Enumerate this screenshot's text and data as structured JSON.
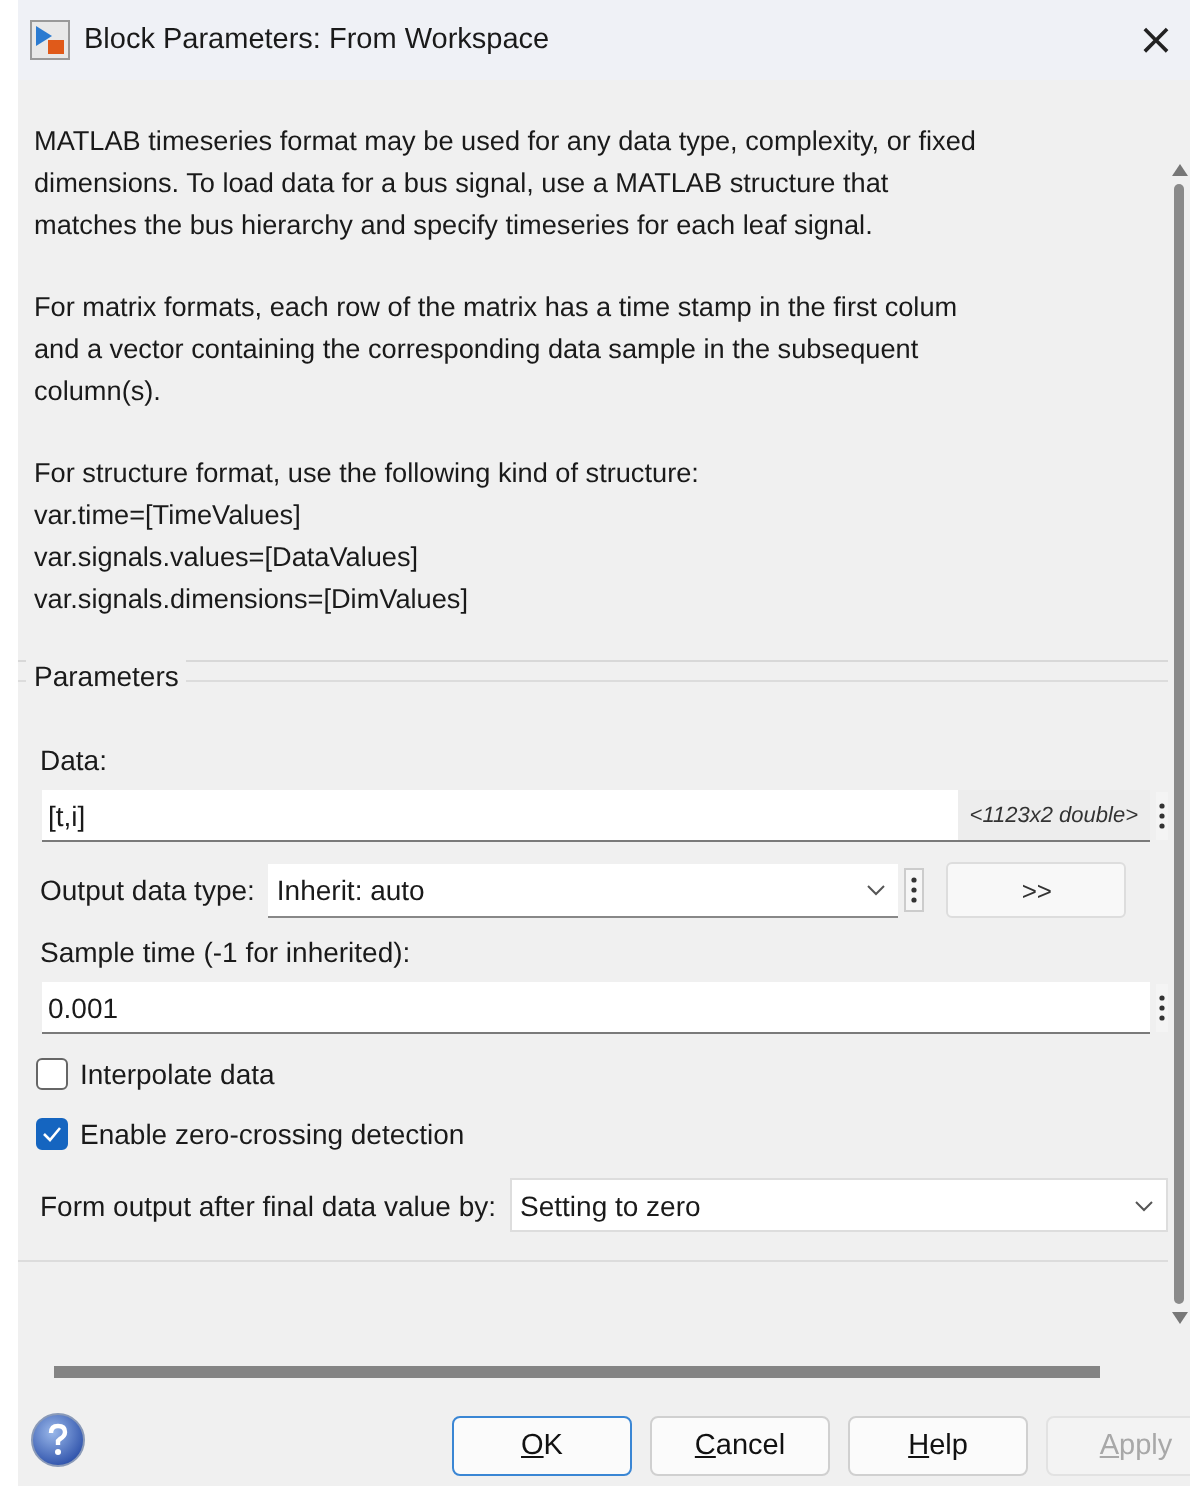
{
  "window": {
    "title": "Block Parameters: From Workspace",
    "close": "×"
  },
  "description": [
    {
      "lines": [
        "MATLAB timeseries format may be used for any data type, complexity, or fixed",
        "dimensions. To load data for a bus signal, use a MATLAB structure that",
        "matches the bus hierarchy and specify timeseries for each leaf signal."
      ]
    },
    {
      "lines": [
        "For matrix formats, each row of the matrix has a time stamp in the first colum",
        "and a vector containing the corresponding data sample in the subsequent",
        "column(s)."
      ]
    },
    {
      "lines": [
        "For structure format, use the following kind of structure:",
        " var.time=[TimeValues]",
        " var.signals.values=[DataValues]",
        " var.signals.dimensions=[DimValues]"
      ]
    }
  ],
  "parameters": {
    "legend": "Parameters",
    "data": {
      "label": "Data:",
      "value": "[t,i]",
      "hint": "<1123x2 double>"
    },
    "output_type": {
      "label": "Output data type:",
      "value": "Inherit: auto",
      "button": ">>"
    },
    "sample_time": {
      "label": "Sample time (-1 for inherited):",
      "value": "0.001"
    },
    "checkboxes": [
      {
        "label": "Interpolate data",
        "checked": false
      },
      {
        "label": "Enable zero-crossing detection",
        "checked": true
      }
    ],
    "form_output": {
      "label": "Form output after final data value by:",
      "value": "Setting to zero"
    }
  },
  "buttons": [
    {
      "key": "O",
      "rest": "K",
      "default": true,
      "disabled": false
    },
    {
      "key": "C",
      "rest": "ancel",
      "default": false,
      "disabled": false
    },
    {
      "key": "H",
      "rest": "elp",
      "default": false,
      "disabled": false
    },
    {
      "key": "A",
      "rest": "pply",
      "default": false,
      "disabled": true
    }
  ]
}
